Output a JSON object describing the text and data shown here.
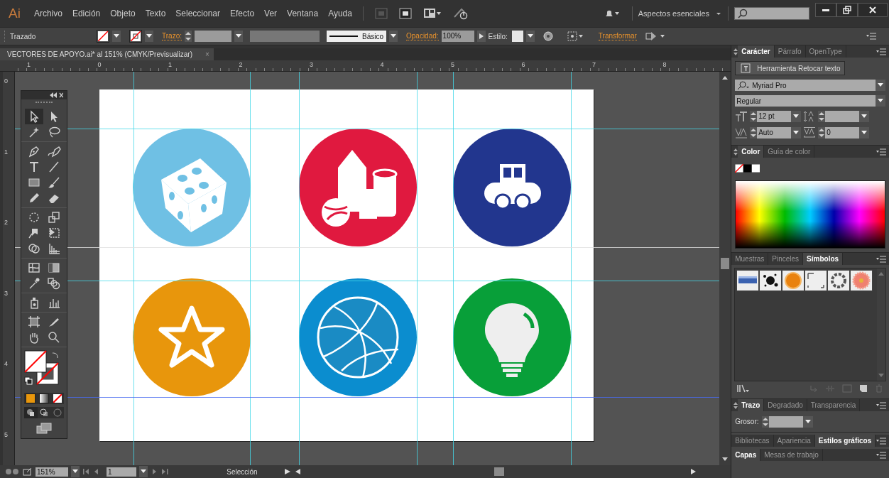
{
  "menu_bar": {
    "logo": "Ai",
    "items": [
      "Archivo",
      "Edición",
      "Objeto",
      "Texto",
      "Seleccionar",
      "Efecto",
      "Ver",
      "Ventana",
      "Ayuda"
    ],
    "workspace": "Aspectos esenciales"
  },
  "control_bar": {
    "selection": "Trazado",
    "stroke_label": "Trazo:",
    "brush": "Básico",
    "opacity_label": "Opacidad:",
    "opacity": "100%",
    "style_label": "Estilo:",
    "transform": "Transformar"
  },
  "document": {
    "tab": {
      "title": "VECTORES DE APOYO.ai* al 151% (CMYK/Previsualizar)",
      "close": "×"
    },
    "ruler_h": [
      "1",
      "0",
      "1",
      "2",
      "3",
      "4",
      "5",
      "6",
      "7",
      "8"
    ],
    "ruler_v": [
      "0",
      "1",
      "2",
      "3",
      "4",
      "5"
    ],
    "artboard_icons": [
      {
        "kind": "dice",
        "color": "#6fc0e4"
      },
      {
        "kind": "blocks",
        "color": "#e0193f"
      },
      {
        "kind": "car",
        "color": "#22368e"
      },
      {
        "kind": "star",
        "color": "#e8960c"
      },
      {
        "kind": "basketball",
        "color": "#0b8dcf"
      },
      {
        "kind": "bulb",
        "color": "#089f39"
      }
    ]
  },
  "tools": {
    "groups": [
      [
        {
          "kind": "selection",
          "selected": true
        },
        {
          "kind": "direct",
          "selected": false
        },
        {
          "kind": "wand",
          "selected": false
        },
        {
          "kind": "lasso",
          "selected": false
        }
      ],
      [
        {
          "kind": "pen",
          "selected": false
        },
        {
          "kind": "curvature",
          "selected": false
        },
        {
          "kind": "type",
          "selected": false
        },
        {
          "kind": "line",
          "selected": false
        },
        {
          "kind": "rect",
          "selected": false
        },
        {
          "kind": "brush",
          "selected": false
        },
        {
          "kind": "pencil",
          "selected": false
        },
        {
          "kind": "eraser",
          "selected": false
        }
      ],
      [
        {
          "kind": "rotate",
          "selected": false
        },
        {
          "kind": "scale",
          "selected": false
        },
        {
          "kind": "warp",
          "selected": false
        },
        {
          "kind": "freetransform",
          "selected": false
        },
        {
          "kind": "shapebuilder",
          "selected": false
        },
        {
          "kind": "perspective",
          "selected": false
        }
      ],
      [
        {
          "kind": "mesh",
          "selected": false
        },
        {
          "kind": "gradient",
          "selected": false
        },
        {
          "kind": "eyedropper",
          "selected": false
        },
        {
          "kind": "blend",
          "selected": false
        }
      ],
      [
        {
          "kind": "sprayer",
          "selected": false
        },
        {
          "kind": "graph",
          "selected": false
        }
      ],
      [
        {
          "kind": "artboard",
          "selected": false
        },
        {
          "kind": "slice",
          "selected": false
        },
        {
          "kind": "hand",
          "selected": false
        },
        {
          "kind": "zoom",
          "selected": false
        }
      ]
    ]
  },
  "status_bar": {
    "zoom": "151%",
    "artboard": "1",
    "info": "Selección"
  },
  "panels": {
    "character": {
      "tabs": [
        {
          "label": "Carácter",
          "selected": true
        },
        {
          "label": "Párrafo",
          "selected": false
        },
        {
          "label": "OpenType",
          "selected": false
        }
      ],
      "retouch_button": "Herramienta Retocar texto",
      "font_family": "Myriad Pro",
      "font_style": "Regular",
      "font_size": "12 pt",
      "kerning": "Auto",
      "tracking": "0"
    },
    "color": {
      "tabs": [
        {
          "label": "Color",
          "selected": true
        },
        {
          "label": "Guía de color",
          "selected": false
        }
      ]
    },
    "symbols": {
      "tabs": [
        {
          "label": "Muestras",
          "selected": false
        },
        {
          "label": "Pinceles",
          "selected": false
        },
        {
          "label": "Símbolos",
          "selected": true
        }
      ],
      "items": [
        {
          "kind": "banner"
        },
        {
          "kind": "splatter"
        },
        {
          "kind": "orb"
        },
        {
          "kind": "frame"
        },
        {
          "kind": "ring"
        },
        {
          "kind": "flower"
        }
      ]
    },
    "stroke": {
      "tabs": [
        {
          "label": "Trazo",
          "selected": true
        },
        {
          "label": "Degradado",
          "selected": false
        },
        {
          "label": "Transparencia",
          "selected": false
        }
      ],
      "weight_label": "Grosor:"
    },
    "collapsed": [
      {
        "tabs": [
          {
            "label": "Bibliotecas",
            "selected": false
          },
          {
            "label": "Apariencia",
            "selected": false
          },
          {
            "label": "Estilos gráficos",
            "selected": true
          }
        ]
      },
      {
        "tabs": [
          {
            "label": "Capas",
            "selected": true
          },
          {
            "label": "Mesas de trabajo",
            "selected": false
          }
        ]
      }
    ]
  }
}
